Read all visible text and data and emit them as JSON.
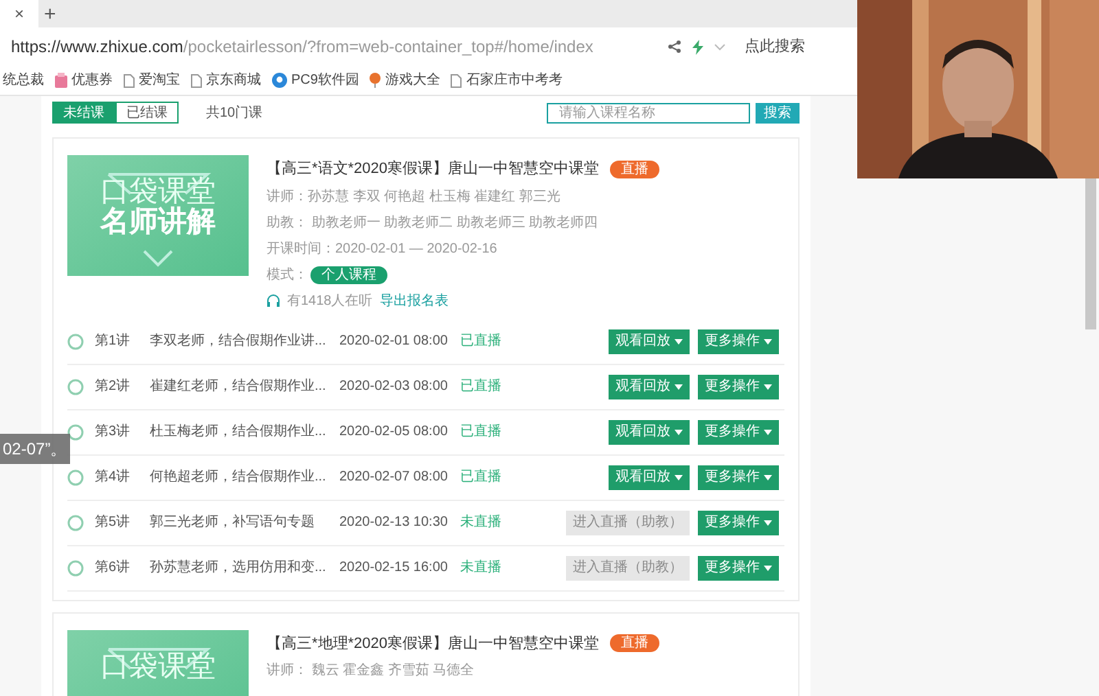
{
  "browser": {
    "tab_close": "×",
    "new_tab": "+",
    "url_host": "https://www.zhixue.com",
    "url_path": "/pocketairlesson/?from=web-container_top#/home/index",
    "search_label": "点此搜索",
    "bookmarks": [
      {
        "label": "统总裁",
        "kind": "plain"
      },
      {
        "label": "优惠券",
        "kind": "coupon"
      },
      {
        "label": "爱淘宝",
        "kind": "page"
      },
      {
        "label": "京东商城",
        "kind": "page"
      },
      {
        "label": "PC9软件园",
        "kind": "app"
      },
      {
        "label": "游戏大全",
        "kind": "game"
      },
      {
        "label": "石家庄市中考考",
        "kind": "page"
      }
    ]
  },
  "filter": {
    "tabs": [
      {
        "label": "未结课",
        "selected": true
      },
      {
        "label": "已结课",
        "selected": false
      }
    ],
    "count": "共10门课",
    "search": {
      "placeholder": "请输入课程名称"
    },
    "search_button": "搜索"
  },
  "courses": [
    {
      "cover_lines": [
        "口袋课堂",
        "名师讲解"
      ],
      "title": "【高三*语文*2020寒假课】唐山一中智慧空中课堂",
      "badge": "直播",
      "teachers": "讲师：孙苏慧 李双 何艳超 杜玉梅 崔建红 郭三光",
      "assistants": "助教： 助教老师一 助教老师二 助教老师三 助教老师四",
      "period": "开课时间：2020-02-01 — 2020-02-16",
      "mode_label": "模式：",
      "mode": "个人课程",
      "listeners": "有1418人在听",
      "export_link": "导出报名表",
      "lessons": [
        {
          "number": "第1讲",
          "title": "李双老师，结合假期作业讲...",
          "time": "2020-02-01 08:00",
          "status": "已直播",
          "action": "观看回放",
          "disabled": false,
          "more": "更多操作"
        },
        {
          "number": "第2讲",
          "title": "崔建红老师，结合假期作业...",
          "time": "2020-02-03 08:00",
          "status": "已直播",
          "action": "观看回放",
          "disabled": false,
          "more": "更多操作"
        },
        {
          "number": "第3讲",
          "title": "杜玉梅老师，结合假期作业...",
          "time": "2020-02-05 08:00",
          "status": "已直播",
          "action": "观看回放",
          "disabled": false,
          "more": "更多操作"
        },
        {
          "number": "第4讲",
          "title": "何艳超老师，结合假期作业...",
          "time": "2020-02-07 08:00",
          "status": "已直播",
          "action": "观看回放",
          "disabled": false,
          "more": "更多操作"
        },
        {
          "number": "第5讲",
          "title": "郭三光老师，补写语句专题",
          "time": "2020-02-13 10:30",
          "status": "未直播",
          "action": "进入直播（助教）",
          "disabled": true,
          "more": "更多操作"
        },
        {
          "number": "第6讲",
          "title": "孙苏慧老师，选用仿用和变...",
          "time": "2020-02-15 16:00",
          "status": "未直播",
          "action": "进入直播（助教）",
          "disabled": true,
          "more": "更多操作"
        }
      ]
    },
    {
      "cover_lines": [
        "口袋课堂"
      ],
      "title": "【高三*地理*2020寒假课】唐山一中智慧空中课堂",
      "badge": "直播",
      "teachers": "讲师： 魏云 霍金鑫 齐雪茹 马德全"
    }
  ],
  "caption": "02-07”。"
}
